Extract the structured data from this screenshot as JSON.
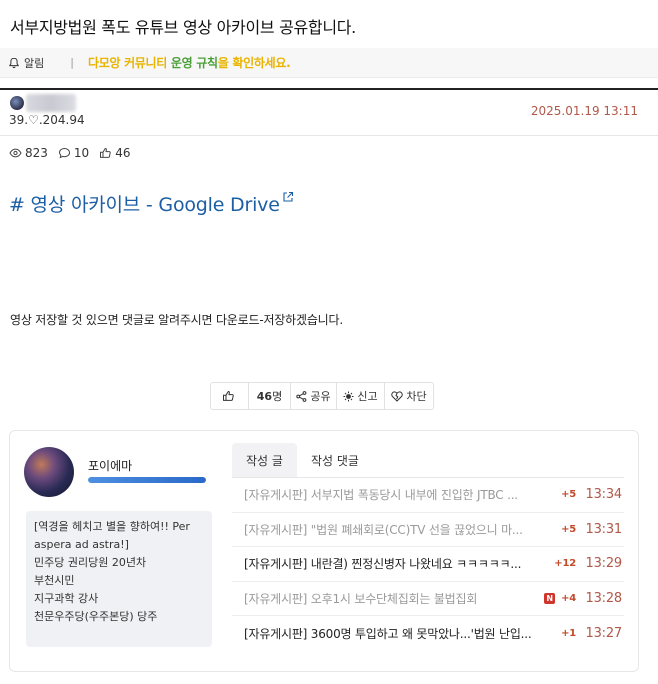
{
  "post": {
    "title": "서부지방법원 폭도 유튜브 영상 아카이브 공유합니다.",
    "author_ip": "39.♡.204.94",
    "date": "2025.01.19 13:11",
    "views": "823",
    "comments": "10",
    "likes": "46",
    "link_text": "# 영상 아카이브 - Google Drive",
    "body": "영상 저장할 것 있으면 댓글로 알려주시면 다운로드-저장하겠습니다."
  },
  "notice": {
    "label": "알림",
    "sep": "|",
    "message_part1": "다모앙 커뮤니티 ",
    "message_part2": "운영 규칙",
    "message_part3": "을 확인하세요."
  },
  "actions": {
    "like_count": "46",
    "like_unit": "명",
    "share": "공유",
    "report": "신고",
    "block": "차단"
  },
  "profile": {
    "name": "포이에마",
    "level_fraction": 1.0,
    "bio_lines": [
      "[역경을 헤치고 별을 향하여!! Per",
      "aspera ad astra!]",
      "민주당 권리당원 20년차",
      "부천시민",
      "지구과학 강사",
      "천문우주당(우주본당) 당주"
    ],
    "tabs": [
      "작성 글",
      "작성 댓글"
    ],
    "posts": [
      {
        "text": "[자유게시판] 서부지법 폭동당시 내부에 진입한 JTBC ...",
        "count": "+5",
        "time": "13:34",
        "read": true,
        "new": false
      },
      {
        "text": "[자유게시판] \"법원 폐쇄회로(CC)TV 선을 끊었으니 마...",
        "count": "+5",
        "time": "13:31",
        "read": true,
        "new": false
      },
      {
        "text": "[자유게시판] 내란결) 찐정신병자 나왔네요 ㅋㅋㅋㅋㅋ...",
        "count": "+12",
        "time": "13:29",
        "read": false,
        "new": false
      },
      {
        "text": "[자유게시판] 오후1시 보수단체집회는 불법집회",
        "count": "+4",
        "time": "13:28",
        "read": true,
        "new": true
      },
      {
        "text": "[자유게시판] 3600명 투입하고 왜 못막았나...'법원 난입...",
        "count": "+1",
        "time": "13:27",
        "read": false,
        "new": false
      }
    ]
  },
  "colors": {
    "link": "#1d5fa5",
    "date": "#b0594a",
    "notice_yellow": "#e8b400",
    "notice_green": "#4c9f38",
    "count_red": "#c24a2a"
  }
}
